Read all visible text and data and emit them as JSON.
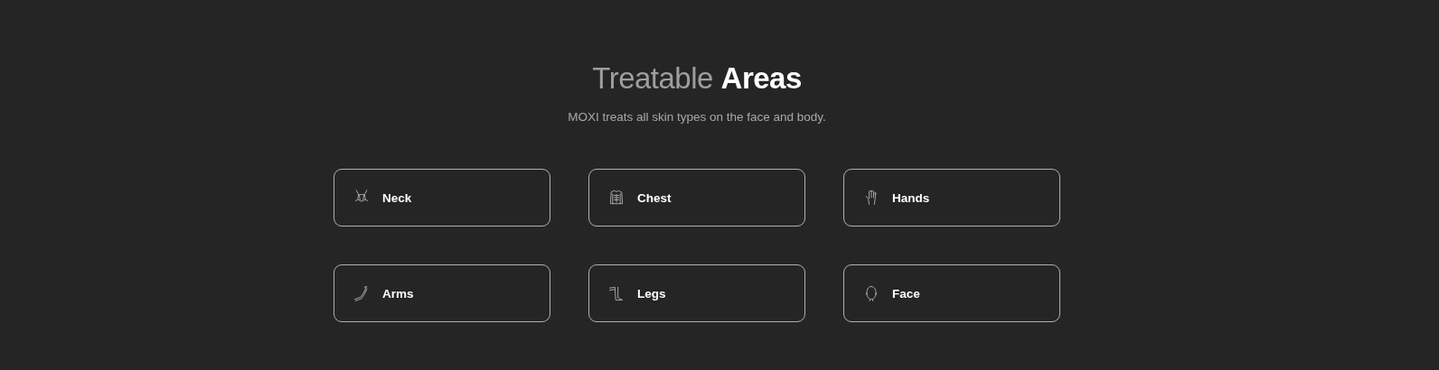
{
  "heading": {
    "lead": "Treatable",
    "emphasis": "Areas"
  },
  "subtitle": "MOXI treats all skin types on the face and body.",
  "areas": [
    {
      "label": "Neck",
      "kind": "neck"
    },
    {
      "label": "Chest",
      "kind": "chest"
    },
    {
      "label": "Hands",
      "kind": "hand"
    },
    {
      "label": "Arms",
      "kind": "arm"
    },
    {
      "label": "Legs",
      "kind": "leg"
    },
    {
      "label": "Face",
      "kind": "face"
    }
  ]
}
